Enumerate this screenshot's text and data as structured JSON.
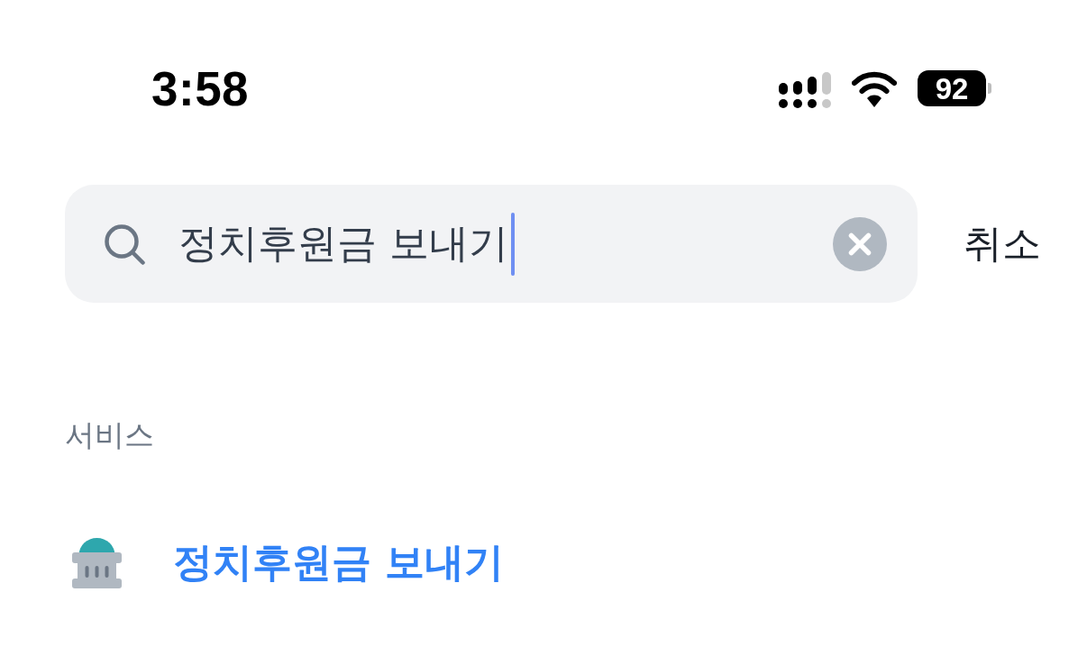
{
  "status_bar": {
    "time": "3:58",
    "battery": "92"
  },
  "search": {
    "value": "정치후원금 보내기",
    "focused": true,
    "cancel": "취소"
  },
  "results": {
    "title": "서비스",
    "items": [
      {
        "label": "정치후원금 보내기"
      }
    ]
  }
}
